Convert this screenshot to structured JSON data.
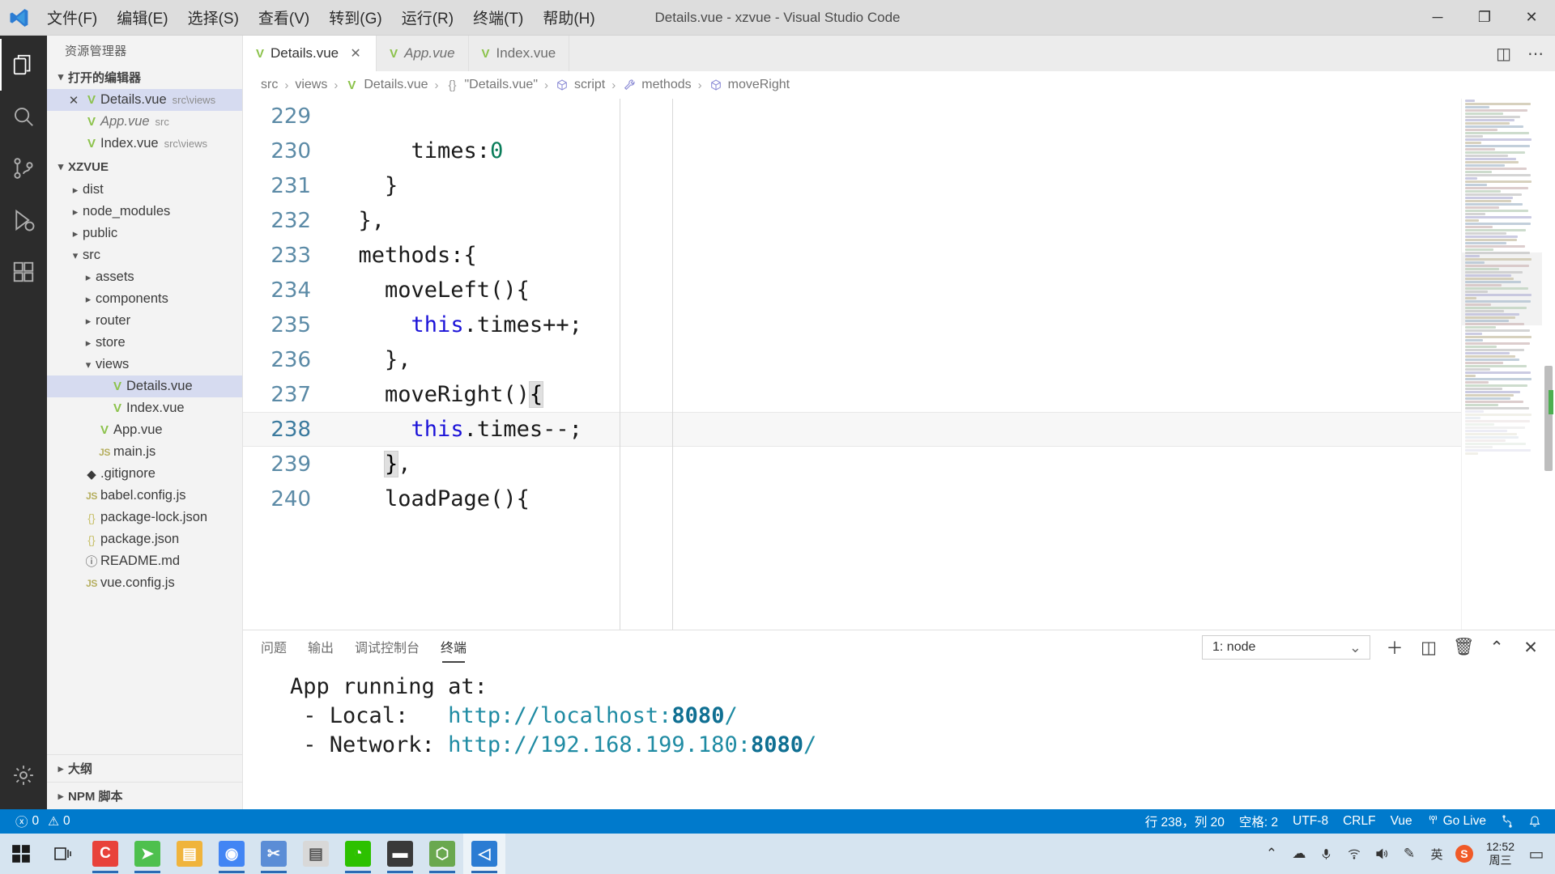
{
  "window": {
    "title": "Details.vue - xzvue - Visual Studio Code",
    "minimize": "─",
    "maximize": "❐",
    "close": "✕"
  },
  "menubar": [
    {
      "label": "文件(F)",
      "name": "menu-file"
    },
    {
      "label": "编辑(E)",
      "name": "menu-edit"
    },
    {
      "label": "选择(S)",
      "name": "menu-selection"
    },
    {
      "label": "查看(V)",
      "name": "menu-view"
    },
    {
      "label": "转到(G)",
      "name": "menu-go"
    },
    {
      "label": "运行(R)",
      "name": "menu-run"
    },
    {
      "label": "终端(T)",
      "name": "menu-terminal"
    },
    {
      "label": "帮助(H)",
      "name": "menu-help"
    }
  ],
  "activitybar": [
    {
      "name": "explorer-icon",
      "label": "资源管理器",
      "active": true
    },
    {
      "name": "search-icon",
      "label": "搜索",
      "active": false
    },
    {
      "name": "source-control-icon",
      "label": "源代码管理",
      "active": false
    },
    {
      "name": "run-debug-icon",
      "label": "运行和调试",
      "active": false
    },
    {
      "name": "extensions-icon",
      "label": "扩展",
      "active": false
    },
    {
      "name": "gear-icon",
      "label": "管理",
      "active": false
    }
  ],
  "sidebar": {
    "title": "资源管理器",
    "open_editors": {
      "label": "打开的编辑器",
      "items": [
        {
          "name": "Details.vue",
          "sub": "src\\views",
          "icon": "vue-icon",
          "selected": true,
          "closable": true,
          "italic": false
        },
        {
          "name": "App.vue",
          "sub": "src",
          "icon": "vue-icon",
          "selected": false,
          "closable": false,
          "italic": true
        },
        {
          "name": "Index.vue",
          "sub": "src\\views",
          "icon": "vue-icon",
          "selected": false,
          "closable": false,
          "italic": false
        }
      ]
    },
    "project": {
      "label": "XZVUE",
      "items": [
        {
          "name": "dist",
          "icon": "folder",
          "depth": 1,
          "expanded": false,
          "selected": false
        },
        {
          "name": "node_modules",
          "icon": "folder",
          "depth": 1,
          "expanded": false,
          "selected": false
        },
        {
          "name": "public",
          "icon": "folder",
          "depth": 1,
          "expanded": false,
          "selected": false
        },
        {
          "name": "src",
          "icon": "folder",
          "depth": 1,
          "expanded": true,
          "selected": false
        },
        {
          "name": "assets",
          "icon": "folder",
          "depth": 2,
          "expanded": false,
          "selected": false
        },
        {
          "name": "components",
          "icon": "folder",
          "depth": 2,
          "expanded": false,
          "selected": false
        },
        {
          "name": "router",
          "icon": "folder",
          "depth": 2,
          "expanded": false,
          "selected": false
        },
        {
          "name": "store",
          "icon": "folder",
          "depth": 2,
          "expanded": false,
          "selected": false
        },
        {
          "name": "views",
          "icon": "folder",
          "depth": 2,
          "expanded": true,
          "selected": false
        },
        {
          "name": "Details.vue",
          "icon": "vue-icon",
          "depth": 3,
          "expanded": null,
          "selected": true
        },
        {
          "name": "Index.vue",
          "icon": "vue-icon",
          "depth": 3,
          "expanded": null,
          "selected": false
        },
        {
          "name": "App.vue",
          "icon": "vue-icon",
          "depth": 2,
          "expanded": null,
          "selected": false
        },
        {
          "name": "main.js",
          "icon": "js-icon",
          "depth": 2,
          "expanded": null,
          "selected": false
        },
        {
          "name": ".gitignore",
          "icon": "git-icon",
          "depth": 1,
          "expanded": null,
          "selected": false
        },
        {
          "name": "babel.config.js",
          "icon": "js-icon",
          "depth": 1,
          "expanded": null,
          "selected": false
        },
        {
          "name": "package-lock.json",
          "icon": "json-icon",
          "depth": 1,
          "expanded": null,
          "selected": false
        },
        {
          "name": "package.json",
          "icon": "json-icon",
          "depth": 1,
          "expanded": null,
          "selected": false
        },
        {
          "name": "README.md",
          "icon": "info-icon",
          "depth": 1,
          "expanded": null,
          "selected": false
        },
        {
          "name": "vue.config.js",
          "icon": "js-icon",
          "depth": 1,
          "expanded": null,
          "selected": false
        }
      ]
    },
    "outline_label": "大纲",
    "npm_label": "NPM 脚本"
  },
  "tabs": [
    {
      "label": "Details.vue",
      "active": true,
      "preview": false,
      "close": "✕"
    },
    {
      "label": "App.vue",
      "active": false,
      "preview": true,
      "close": ""
    },
    {
      "label": "Index.vue",
      "active": false,
      "preview": false,
      "close": ""
    }
  ],
  "tab_actions": [
    {
      "name": "split-editor-icon",
      "glyph": "◫"
    },
    {
      "name": "more-actions-icon",
      "glyph": "⋯"
    }
  ],
  "breadcrumb": [
    {
      "label": "src",
      "icon": ""
    },
    {
      "label": "views",
      "icon": ""
    },
    {
      "label": "Details.vue",
      "icon": "vue-icon"
    },
    {
      "label": "\"Details.vue\"",
      "icon": "braces-icon"
    },
    {
      "label": "script",
      "icon": "module-icon"
    },
    {
      "label": "methods",
      "icon": "wrench-icon"
    },
    {
      "label": "moveRight",
      "icon": "module-icon"
    }
  ],
  "editor": {
    "lines": [
      {
        "num": "229",
        "text": "",
        "indent": 0,
        "current": false
      },
      {
        "num": "230",
        "text": "      times:0",
        "indent": 0,
        "current": false,
        "tokens": [
          {
            "t": "      times:",
            "c": "tok"
          },
          {
            "t": "0",
            "c": "num"
          }
        ]
      },
      {
        "num": "231",
        "text": "    }",
        "indent": 0,
        "current": false,
        "tokens": [
          {
            "t": "    }",
            "c": "tok"
          }
        ]
      },
      {
        "num": "232",
        "text": "  },",
        "indent": 0,
        "current": false,
        "tokens": [
          {
            "t": "  },",
            "c": "tok"
          }
        ]
      },
      {
        "num": "233",
        "text": "  methods:{",
        "indent": 0,
        "current": false,
        "tokens": [
          {
            "t": "  methods:{",
            "c": "tok"
          }
        ]
      },
      {
        "num": "234",
        "text": "    moveLeft(){",
        "indent": 0,
        "current": false,
        "tokens": [
          {
            "t": "    moveLeft(){",
            "c": "tok"
          }
        ]
      },
      {
        "num": "235",
        "text": "      this.times++;",
        "indent": 0,
        "current": false,
        "tokens": [
          {
            "t": "      ",
            "c": "tok"
          },
          {
            "t": "this",
            "c": "kw-this"
          },
          {
            "t": ".times++;",
            "c": "tok"
          }
        ]
      },
      {
        "num": "236",
        "text": "    },",
        "indent": 0,
        "current": false,
        "tokens": [
          {
            "t": "    },",
            "c": "tok"
          }
        ]
      },
      {
        "num": "237",
        "text": "    moveRight(){",
        "indent": 0,
        "current": false,
        "tokens": [
          {
            "t": "    moveRight()",
            "c": "tok"
          },
          {
            "t": "{",
            "c": "hl-brace"
          }
        ]
      },
      {
        "num": "238",
        "text": "      this.times--;",
        "indent": 0,
        "current": true,
        "tokens": [
          {
            "t": "      ",
            "c": "tok"
          },
          {
            "t": "this",
            "c": "kw-this"
          },
          {
            "t": ".times--;",
            "c": "tok"
          }
        ]
      },
      {
        "num": "239",
        "text": "    },",
        "indent": 0,
        "current": false,
        "tokens": [
          {
            "t": "    ",
            "c": "tok"
          },
          {
            "t": "}",
            "c": "hl-brace"
          },
          {
            "t": ",",
            "c": "tok"
          }
        ]
      },
      {
        "num": "240",
        "text": "    loadPage(){",
        "indent": 0,
        "current": false,
        "tokens": [
          {
            "t": "    loadPage(){",
            "c": "tok"
          }
        ]
      }
    ]
  },
  "panel": {
    "tabs": [
      {
        "label": "问题",
        "active": false,
        "name": "panel-tab-problems"
      },
      {
        "label": "输出",
        "active": false,
        "name": "panel-tab-output"
      },
      {
        "label": "调试控制台",
        "active": false,
        "name": "panel-tab-debug-console"
      },
      {
        "label": "终端",
        "active": true,
        "name": "panel-tab-terminal"
      }
    ],
    "terminal_select": "1: node",
    "chevron": "⌄",
    "actions": [
      {
        "name": "new-terminal-icon",
        "glyph": "＋"
      },
      {
        "name": "split-terminal-icon",
        "glyph": "◫"
      },
      {
        "name": "kill-terminal-icon",
        "glyph": "🗑"
      },
      {
        "name": "maximize-panel-icon",
        "glyph": "⌃"
      },
      {
        "name": "close-panel-icon",
        "glyph": "✕"
      }
    ],
    "terminal_output": [
      {
        "segments": [
          {
            "t": "App running at:",
            "c": "plain"
          }
        ]
      },
      {
        "segments": [
          {
            "t": " - Local:   ",
            "c": "plain"
          },
          {
            "t": "http://localhost:",
            "c": "url"
          },
          {
            "t": "8080",
            "c": "port"
          },
          {
            "t": "/",
            "c": "url"
          }
        ]
      },
      {
        "segments": [
          {
            "t": " - Network: ",
            "c": "plain"
          },
          {
            "t": "http://192.168.199.180:",
            "c": "url"
          },
          {
            "t": "8080",
            "c": "port"
          },
          {
            "t": "/",
            "c": "url"
          }
        ]
      }
    ]
  },
  "statusbar": {
    "errors": "0",
    "warnings": "0",
    "error_icon": "ⓧ",
    "warning_icon": "⚠",
    "right": [
      {
        "label": "行 238，列 20",
        "name": "status-cursor-position"
      },
      {
        "label": "空格: 2",
        "name": "status-indentation"
      },
      {
        "label": "UTF-8",
        "name": "status-encoding"
      },
      {
        "label": "CRLF",
        "name": "status-eol"
      },
      {
        "label": "Vue",
        "name": "status-language-mode"
      },
      {
        "label": "Go Live",
        "name": "status-go-live",
        "icon": "broadcast-icon"
      },
      {
        "label": "",
        "name": "status-remote-icon",
        "icon": "remote-icon"
      },
      {
        "label": "",
        "name": "status-notifications-icon",
        "icon": "bell-icon"
      }
    ]
  },
  "taskbar": {
    "start": "⊞",
    "taskview": "☰",
    "apps": [
      {
        "name": "taskbar-clion",
        "glyph": "C",
        "color": "#e8423a",
        "running": true
      },
      {
        "name": "taskbar-sourcetree",
        "glyph": "➤",
        "color": "#4ec04e",
        "running": true
      },
      {
        "name": "taskbar-file-explorer",
        "glyph": "▤",
        "color": "#f0b43c",
        "running": false
      },
      {
        "name": "taskbar-chrome",
        "glyph": "◉",
        "color": "#4285f4",
        "running": true
      },
      {
        "name": "taskbar-snipaste",
        "glyph": "✂",
        "color": "#5b8dd6",
        "running": true
      },
      {
        "name": "taskbar-notepad",
        "glyph": "▤",
        "color": "#c7c7c7",
        "running": false
      },
      {
        "name": "taskbar-wechat",
        "glyph": "◔",
        "color": "#2dc100",
        "running": true
      },
      {
        "name": "taskbar-cmd",
        "glyph": "▬",
        "color": "#3a3a3a",
        "running": true
      },
      {
        "name": "taskbar-nodejs",
        "glyph": "⬡",
        "color": "#6aa84f",
        "running": true
      },
      {
        "name": "taskbar-vscode",
        "glyph": "◁",
        "color": "#2b7cd3",
        "running": true,
        "focused": true
      }
    ],
    "tray": [
      {
        "name": "show-hidden-icons",
        "glyph": "⌃"
      },
      {
        "name": "onedrive-icon",
        "glyph": "☁"
      },
      {
        "name": "microphone-icon",
        "glyph": "🎤"
      },
      {
        "name": "wifi-icon",
        "glyph": "◠"
      },
      {
        "name": "volume-icon",
        "glyph": "🔊"
      },
      {
        "name": "pen-icon",
        "glyph": "✎"
      },
      {
        "name": "ime-icon",
        "glyph": "英"
      },
      {
        "name": "sogou-icon",
        "glyph": "S"
      }
    ],
    "time": "12:52",
    "date": "周三",
    "action_center": "▭"
  }
}
